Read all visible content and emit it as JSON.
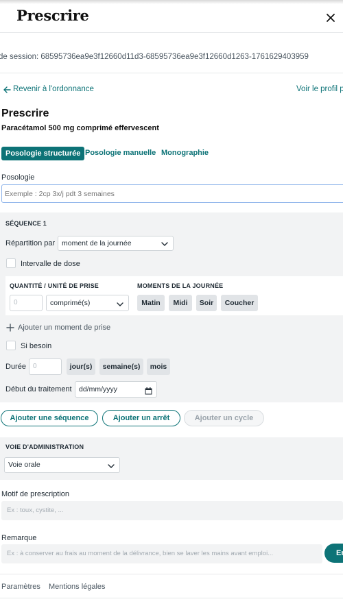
{
  "header": {
    "title": "Prescrire"
  },
  "session": {
    "text": "de session: 68595736ea9e3f12660d11d3-68595736ea9e3f12660d1263-1761629403959"
  },
  "nav": {
    "back": "Revenir à l'ordonnance",
    "profile": "Voir le profil p"
  },
  "main": {
    "title": "Prescrire",
    "drug": "Paracétamol 500 mg comprimé effervescent",
    "tabs": [
      {
        "label": "Posologie structurée",
        "active": true
      },
      {
        "label": "Posologie manuelle"
      },
      {
        "label": "Monographie"
      }
    ]
  },
  "posologie": {
    "label": "Posologie",
    "placeholder": "Exemple : 2cp 3x/j pdt 3 semaines"
  },
  "sequence": {
    "title": "SÉQUENCE 1",
    "repartition_label": "Répartition par",
    "repartition_value": "moment de la journée",
    "intervalle_label": "Intervalle de dose",
    "qty_header": "QUANTITÉ / UNITÉ DE PRISE",
    "moments_header": "MOMENTS DE LA JOURNÉE",
    "qty_placeholder": "0",
    "unit_value": "comprimé(s)",
    "moments": [
      "Matin",
      "Midi",
      "Soir",
      "Coucher"
    ],
    "add_moment": "Ajouter un moment de prise",
    "si_besoin": "Si besoin",
    "duree_label": "Durée",
    "duree_placeholder": "0",
    "duree_units": [
      "jour(s)",
      "semaine(s)",
      "mois"
    ],
    "debut_label": "Début du traitement",
    "date_placeholder": "dd/mm/yyyy"
  },
  "actions": {
    "add_sequence": "Ajouter une séquence",
    "add_stop": "Ajouter un arrêt",
    "add_cycle": "Ajouter un cycle"
  },
  "voie": {
    "title": "VOIE D'ADMINISTRATION",
    "value": "Voie orale"
  },
  "motif": {
    "label": "Motif de prescription",
    "placeholder": "Ex : toux, cystite, ..."
  },
  "remarque": {
    "label": "Remarque",
    "placeholder": "Ex : à conserver au frais au moment de la délivrance, bien se laver les mains avant emploi...",
    "send_label": "En"
  },
  "footer": {
    "parametres": "Paramètres",
    "mentions": "Mentions légales"
  },
  "colors": {
    "accent": "#0d7377",
    "panel": "#f2f3f4",
    "chip": "#e1e4e7"
  }
}
